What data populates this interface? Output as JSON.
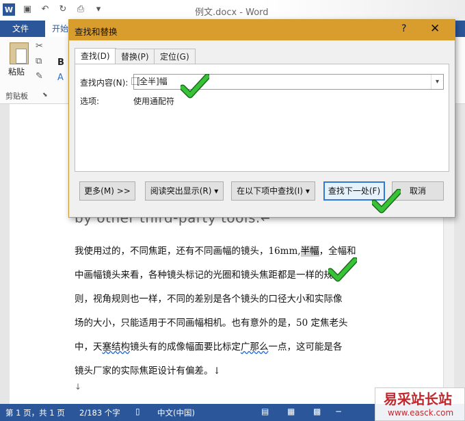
{
  "window": {
    "title": "例文.docx - Word"
  },
  "ribbon": {
    "tabs": {
      "file": "文件",
      "home": "开始"
    },
    "paste_label": "粘贴",
    "clipboard_group": "剪贴板",
    "bold": "B",
    "styles_letter": "A"
  },
  "dialog": {
    "title": "查找和替换",
    "help": "?",
    "close": "✕",
    "tabs": [
      "查找(D)",
      "替换(P)",
      "定位(G)"
    ],
    "find_label": "查找内容(N):",
    "find_value": "[⃞全半]幅",
    "options_label": "选项:",
    "options_value": "使用通配符",
    "buttons": {
      "more": "更多(M) >>",
      "reading_highlight": "阅读突出显示(R) ▾",
      "find_in": "在以下项中查找(I) ▾",
      "find_next": "查找下一处(F)",
      "cancel": "取消"
    }
  },
  "document": {
    "english_line": "by other third-party tools.↵",
    "lines": [
      [
        "我使用过的，不同焦距，还有不同画幅的镜头，16mm,",
        "半幅",
        "，全幅和"
      ],
      "中画幅镜头来看，各种镜头标记的光圈和镜头焦距都是一样的规",
      "则，视角规则也一样，不同的差别是各个镜头的口径大小和实际像",
      "场的大小，只能适用于不同画幅相机。也有意外的是，50 定焦老头",
      [
        "中，天",
        "塞结构",
        "镜头有的成像幅面要比标定",
        "广那么",
        "一点，这可能是各"
      ],
      "镜头厂家的实际焦距设计有偏差。↓"
    ],
    "end_mark": "↓"
  },
  "statusbar": {
    "page": "第 1 页，共 1 页",
    "words": "2/183 个字",
    "language": "中文(中国)"
  },
  "watermark": {
    "name": "易采站长站",
    "url": "www.easck.com"
  },
  "colors": {
    "word_blue": "#2b579a",
    "dialog_title": "#d89d2c",
    "check_green": "#2fae2f"
  }
}
